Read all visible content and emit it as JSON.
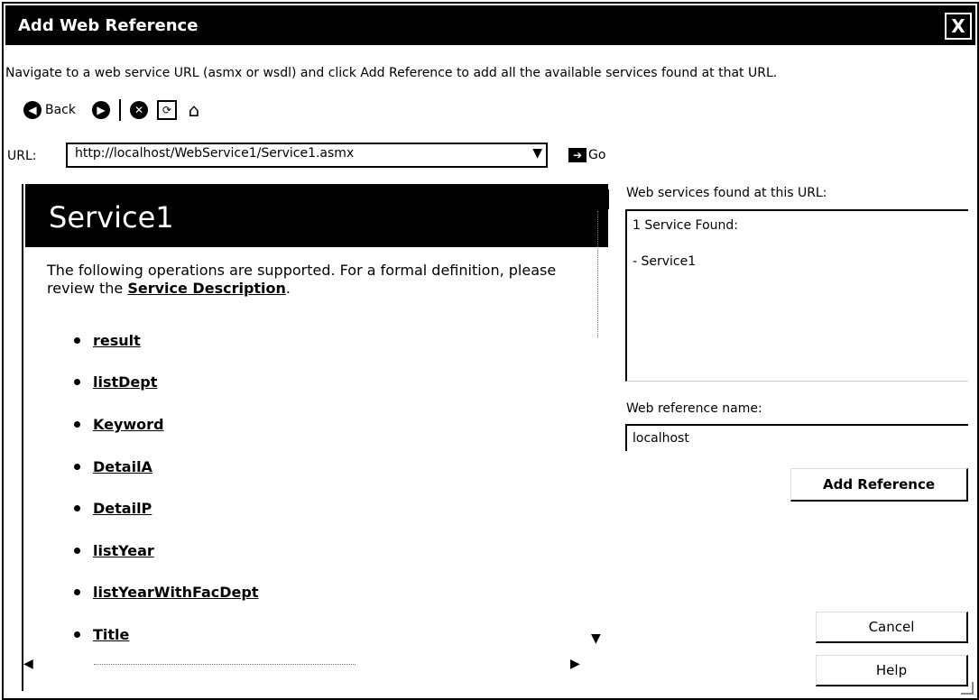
{
  "window": {
    "title": "Add Web Reference",
    "close_glyph": "X"
  },
  "instruction": "Navigate to a web service URL (asmx or wsdl) and click Add Reference to add all the available services found at that URL.",
  "toolbar": {
    "back_label": "Back",
    "icons": [
      "back-icon",
      "forward-icon",
      "stop-icon",
      "refresh-icon",
      "home-icon"
    ]
  },
  "url": {
    "label": "URL:",
    "value": "http://localhost/WebService1/Service1.asmx",
    "go_label": "Go"
  },
  "browser": {
    "service_title": "Service1",
    "intro_text": "The following operations are supported. For a formal definition, please review the ",
    "intro_link": "Service Description",
    "intro_end": ".",
    "operations": [
      "result",
      "listDept",
      "Keyword",
      "DetailA",
      "DetailP",
      "listYear",
      "listYearWithFacDept",
      "Title"
    ]
  },
  "found": {
    "label": "Web services found at this URL:",
    "count_text": "1 Service Found:",
    "service_item": "- Service1"
  },
  "reference": {
    "label": "Web reference name:",
    "value": "localhost"
  },
  "buttons": {
    "add_reference": "Add Reference",
    "cancel": "Cancel",
    "help": "Help"
  }
}
